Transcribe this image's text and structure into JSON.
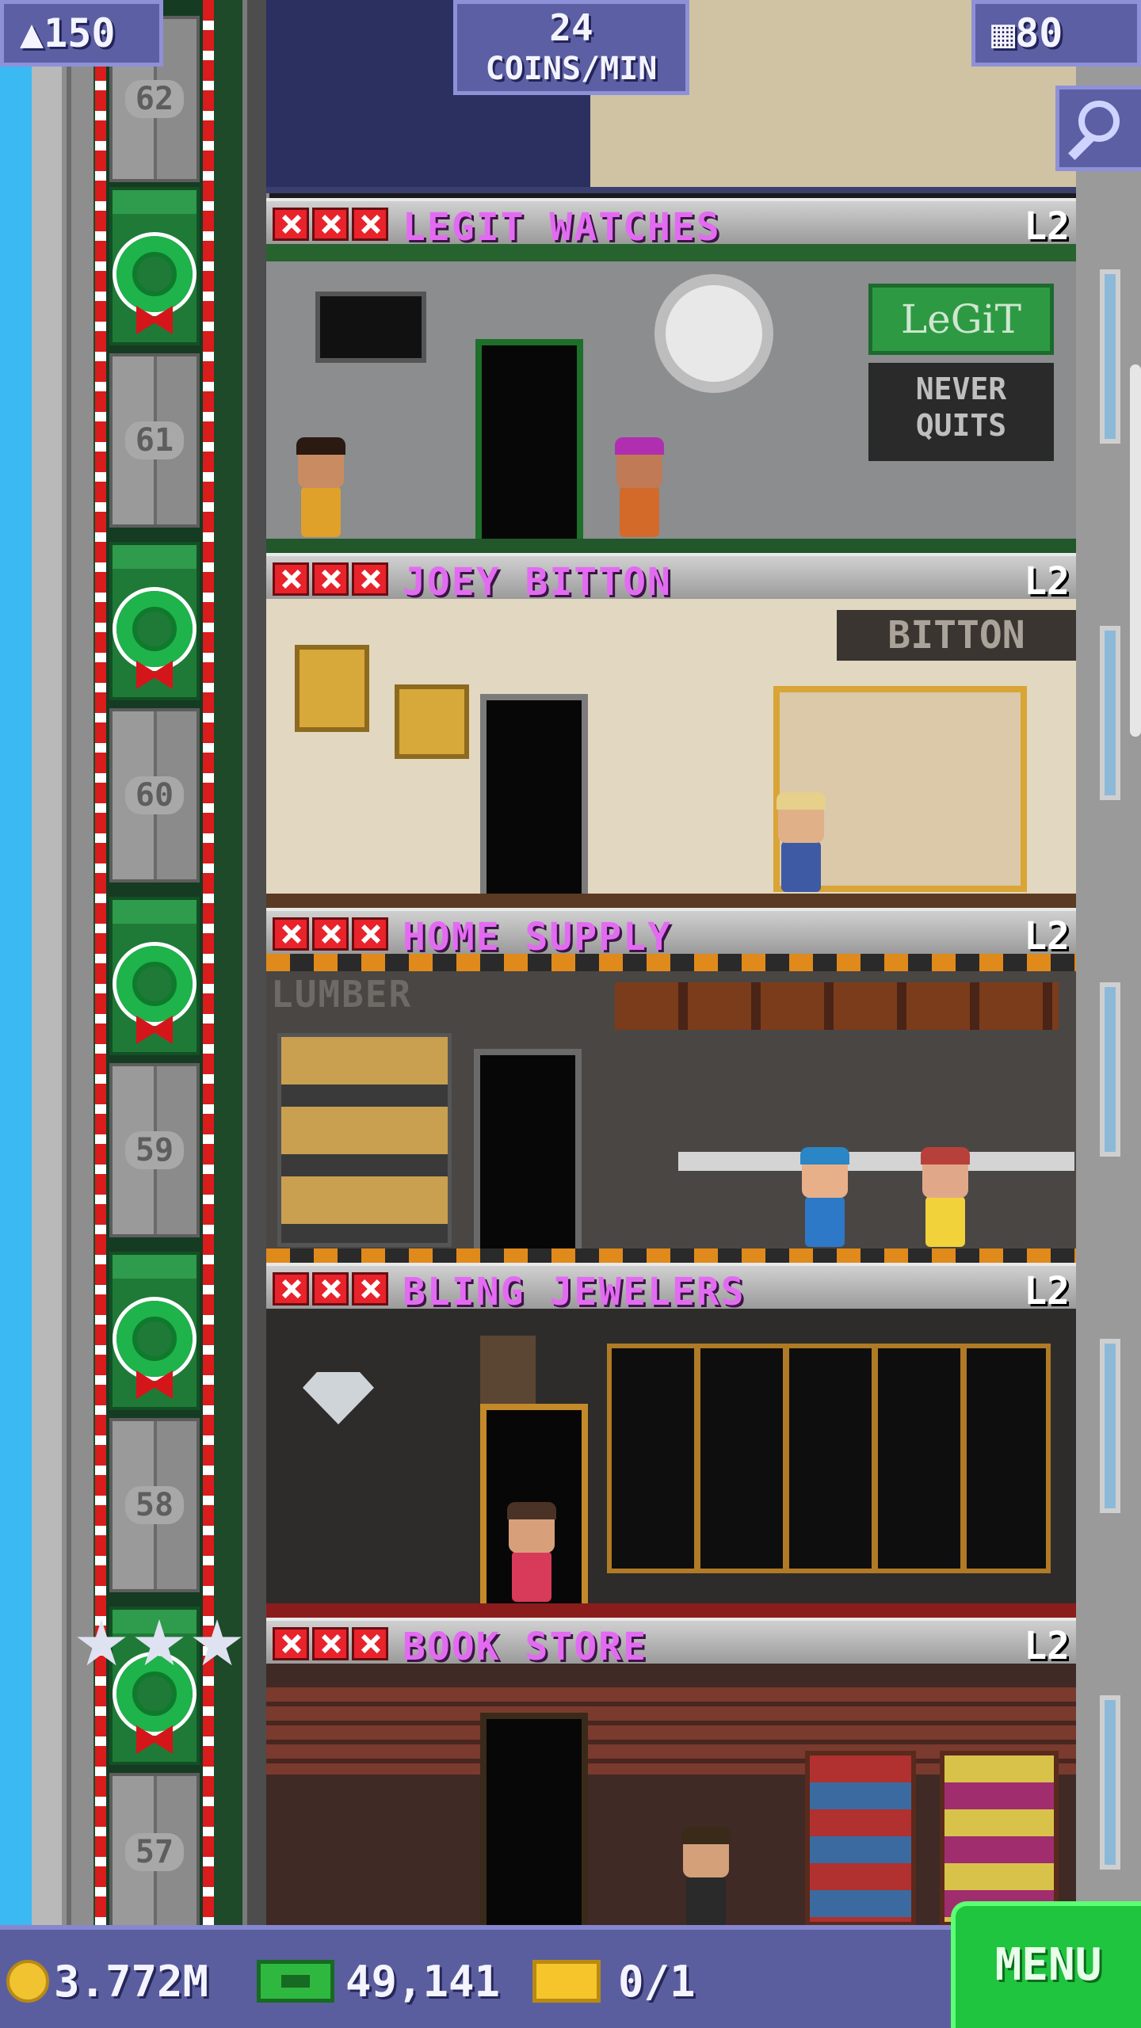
{
  "hud": {
    "population": "150",
    "coins_rate_value": "24",
    "coins_rate_unit": "COINS/MIN",
    "floors": "80"
  },
  "elevator": {
    "floor_numbers": [
      "62",
      "61",
      "60",
      "59",
      "58",
      "57"
    ]
  },
  "floors": [
    {
      "name": "LEGIT WATCHES",
      "level": "L2",
      "sign_brand": "LeGiT",
      "sign_slogan": "NEVER QUITS"
    },
    {
      "name": "JOEY BITTON",
      "level": "L2",
      "sign_brand": "BITTON"
    },
    {
      "name": "HOME SUPPLY",
      "level": "L2",
      "sign_brand": "LUMBER"
    },
    {
      "name": "BLING JEWELERS",
      "level": "L2"
    },
    {
      "name": "BOOK STORE",
      "level": "L2"
    }
  ],
  "bottom": {
    "coins": "3.772M",
    "bux": "49,141",
    "tickets": "0/1",
    "menu_label": "MENU"
  },
  "colors": {
    "store_name": "#e36bf2",
    "hud_bg": "#5c5fa3",
    "menu_bg": "#1fc53e",
    "sky": "#3ab9f2"
  },
  "icons": [
    "population-icon",
    "floors-icon",
    "search-icon",
    "coin-icon",
    "bux-icon",
    "ticket-icon",
    "wreath-icon",
    "star-icon"
  ]
}
